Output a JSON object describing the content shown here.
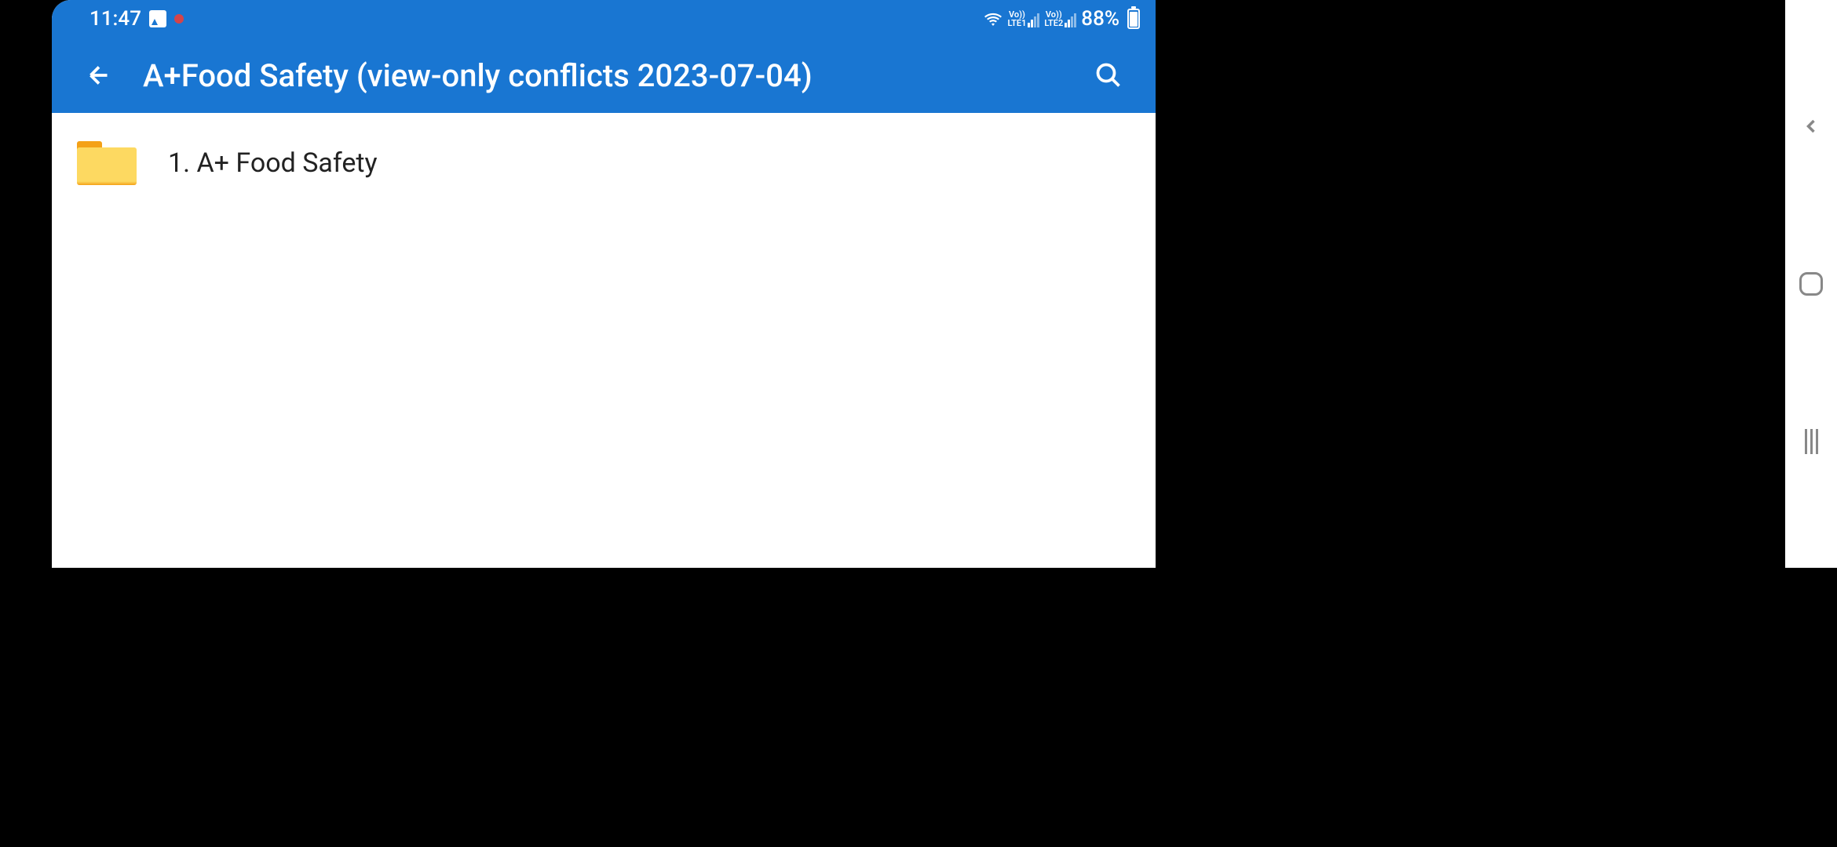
{
  "statusBar": {
    "time": "11:47",
    "battery": "88%",
    "sim1": "LTE1",
    "sim2": "LTE2",
    "vo": "Vo))"
  },
  "header": {
    "title": "A+Food Safety (view-only conflicts 2023-07-04)"
  },
  "folders": [
    {
      "name": "1. A+ Food Safety"
    }
  ]
}
